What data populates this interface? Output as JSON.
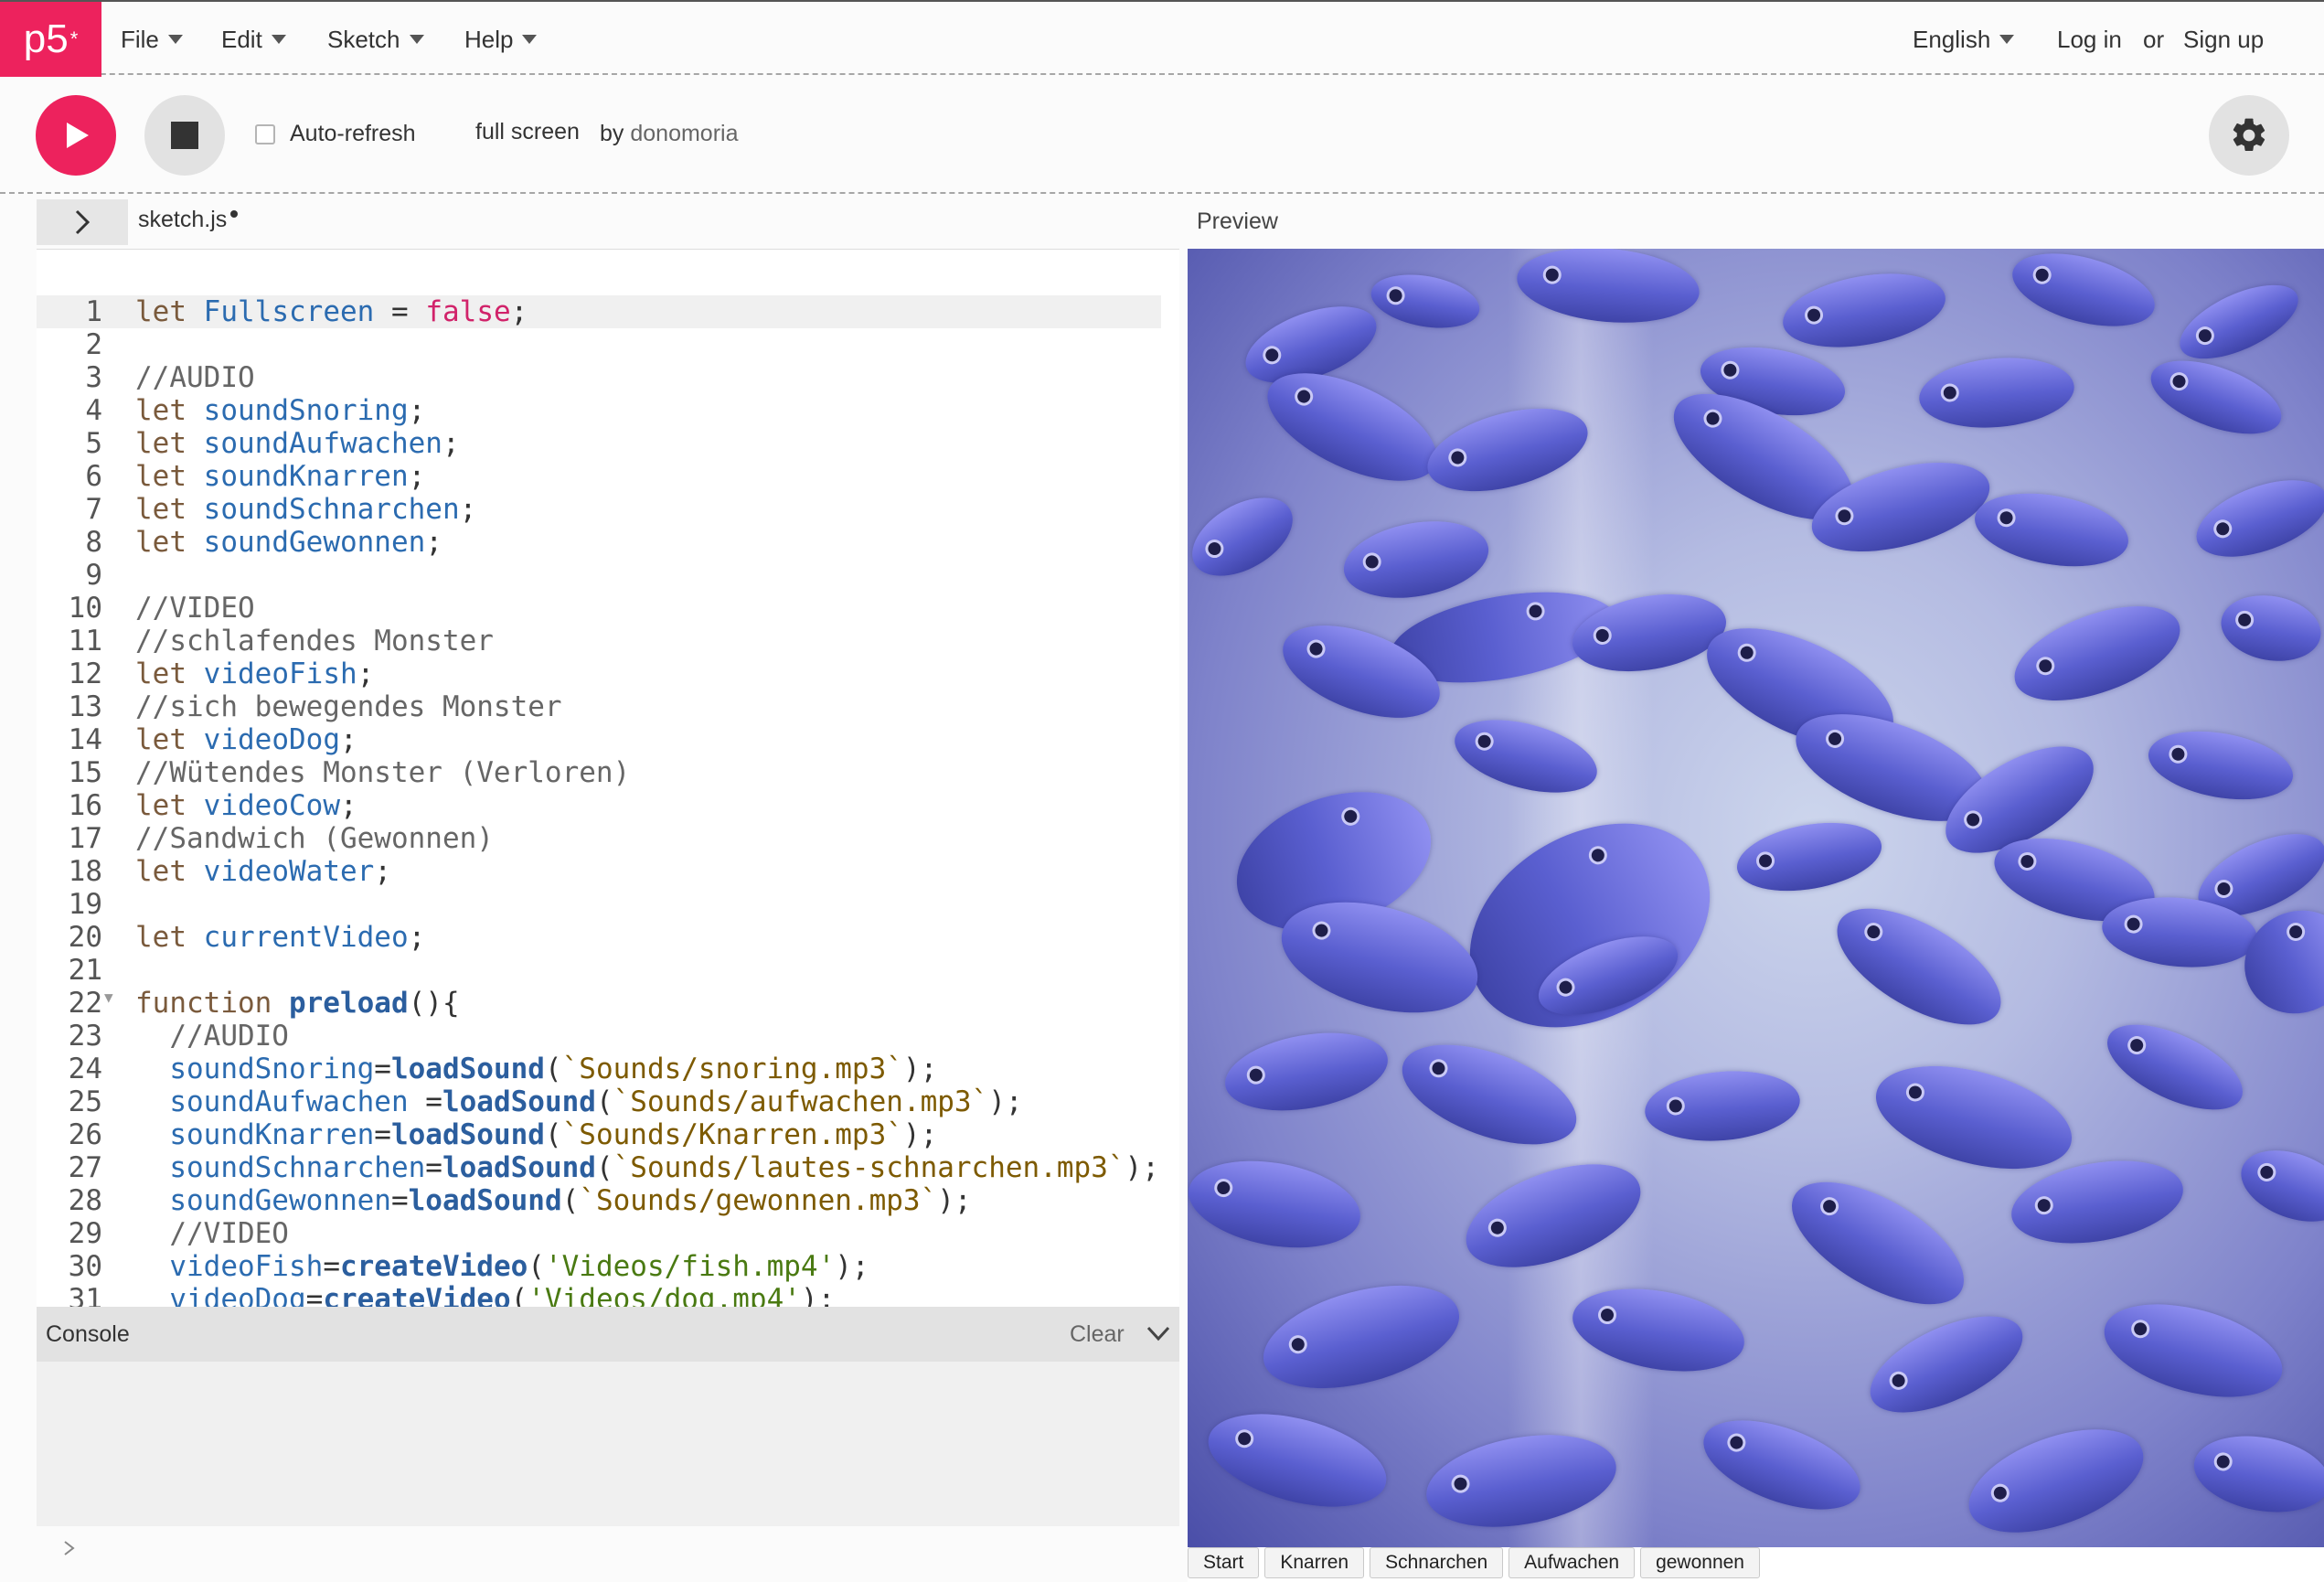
{
  "nav": {
    "logo_text": "p5",
    "logo_sup": "*",
    "menus": [
      {
        "label": "File"
      },
      {
        "label": "Edit"
      },
      {
        "label": "Sketch"
      },
      {
        "label": "Help"
      }
    ],
    "language": "English",
    "login": "Log in",
    "or": "or",
    "signup": "Sign up"
  },
  "toolbar": {
    "play_icon": "play-icon",
    "stop_icon": "stop-icon",
    "autorefresh_label": "Auto-refresh",
    "autorefresh_checked": false,
    "sketch_name": "full screen",
    "by": "by",
    "author": "donomoria",
    "settings_icon": "gear-icon"
  },
  "editor": {
    "file_name": "sketch.js",
    "unsaved": true,
    "preview_label": "Preview",
    "lines": [
      "let Fullscreen = false;",
      "",
      "//AUDIO",
      "let soundSnoring;",
      "let soundAufwachen;",
      "let soundKnarren;",
      "let soundSchnarchen;",
      "let soundGewonnen;",
      "",
      "//VIDEO",
      "//schlafendes Monster",
      "let videoFish;",
      "//sich bewegendes Monster",
      "let videoDog;",
      "//Wütendes Monster (Verloren)",
      "let videoCow;",
      "//Sandwich (Gewonnen)",
      "let videoWater;",
      "",
      "let currentVideo;",
      "",
      "function preload(){",
      "  //AUDIO",
      "  soundSnoring=loadSound(`Sounds/snoring.mp3`);",
      "  soundAufwachen =loadSound(`Sounds/aufwachen.mp3`);",
      "  soundKnarren=loadSound(`Sounds/Knarren.mp3`);",
      "  soundSchnarchen=loadSound(`Sounds/lautes-schnarchen.mp3`);",
      "  soundGewonnen=loadSound(`Sounds/gewonnen.mp3`);",
      "  //VIDEO",
      "  videoFish=createVideo('Videos/fish.mp4');",
      "  videoDog=createVideo('Videos/dog.mp4');"
    ]
  },
  "console": {
    "title": "Console",
    "clear": "Clear"
  },
  "preview_buttons": [
    {
      "label": "Start"
    },
    {
      "label": "Knarren"
    },
    {
      "label": "Schnarchen"
    },
    {
      "label": "Aufwachen"
    },
    {
      "label": "gewonnen"
    }
  ],
  "colors": {
    "brand": "#ed225d",
    "keyword": "#7a5a3c",
    "variable": "#2b6bb0",
    "boolean": "#d1236a",
    "function": "#2b5e9e",
    "string_backtick": "#7d5a00",
    "string_quote": "#4a7a12"
  }
}
